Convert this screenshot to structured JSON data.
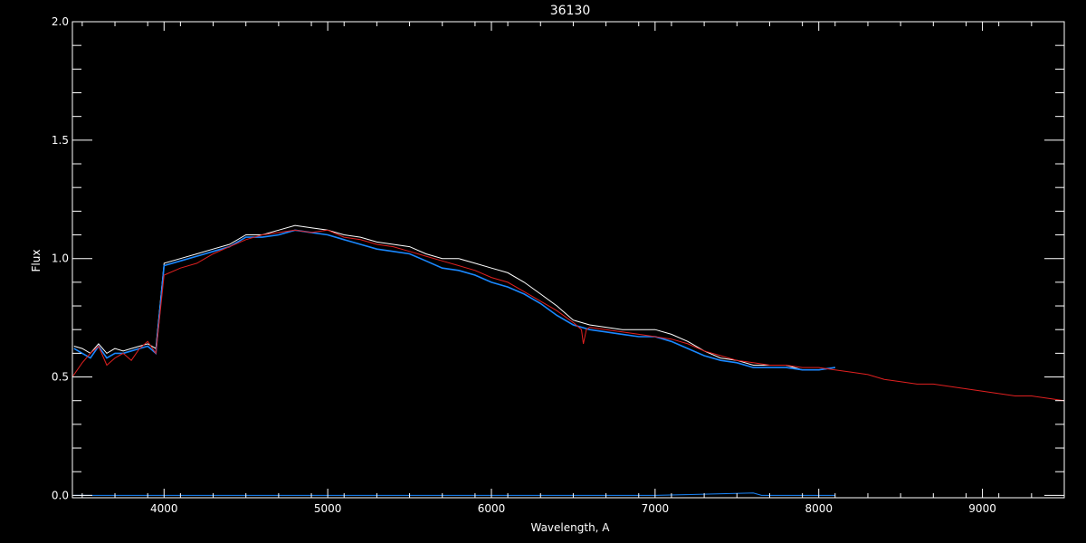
{
  "chart_data": {
    "type": "line",
    "title": "36130",
    "xlabel": "Wavelength, A",
    "ylabel": "Flux",
    "xlim": [
      3440,
      9500
    ],
    "ylim": [
      -0.01,
      2.0
    ],
    "x_ticks": [
      4000,
      5000,
      6000,
      7000,
      8000,
      9000
    ],
    "y_ticks": [
      0.0,
      0.5,
      1.0,
      1.5,
      2.0
    ],
    "x_tick_labels": [
      "4000",
      "5000",
      "6000",
      "7000",
      "8000",
      "9000"
    ],
    "y_tick_labels": [
      "0.0",
      "0.5",
      "1.0",
      "1.5",
      "2.0"
    ],
    "grid": false,
    "background": "#000000",
    "axis_color": "#ffffff",
    "series": [
      {
        "color": "#ffffff",
        "x": [
          3450,
          3500,
          3550,
          3600,
          3650,
          3700,
          3750,
          3800,
          3850,
          3900,
          3950,
          4000,
          4100,
          4200,
          4300,
          4400,
          4500,
          4600,
          4700,
          4800,
          4900,
          5000,
          5100,
          5200,
          5300,
          5400,
          5500,
          5600,
          5700,
          5800,
          5900,
          6000,
          6100,
          6200,
          6300,
          6400,
          6500,
          6600,
          6700,
          6800,
          6900,
          7000,
          7100,
          7200,
          7300,
          7400,
          7500,
          7600,
          7700,
          7800,
          7900,
          8000,
          8100
        ],
        "y": [
          0.63,
          0.62,
          0.6,
          0.64,
          0.6,
          0.62,
          0.61,
          0.62,
          0.63,
          0.64,
          0.62,
          0.98,
          1.0,
          1.02,
          1.04,
          1.06,
          1.1,
          1.1,
          1.12,
          1.14,
          1.13,
          1.12,
          1.1,
          1.09,
          1.07,
          1.06,
          1.05,
          1.02,
          1.0,
          1.0,
          0.98,
          0.96,
          0.94,
          0.9,
          0.85,
          0.8,
          0.74,
          0.72,
          0.71,
          0.7,
          0.7,
          0.7,
          0.68,
          0.65,
          0.61,
          0.58,
          0.57,
          0.55,
          0.55,
          0.55,
          0.53,
          0.53,
          0.54
        ]
      },
      {
        "color": "#1a88ff",
        "x": [
          3450,
          3500,
          3550,
          3600,
          3650,
          3700,
          3750,
          3800,
          3850,
          3900,
          3950,
          4000,
          4100,
          4200,
          4300,
          4400,
          4500,
          4600,
          4700,
          4800,
          4900,
          5000,
          5100,
          5200,
          5300,
          5400,
          5500,
          5600,
          5700,
          5800,
          5900,
          6000,
          6100,
          6200,
          6300,
          6400,
          6500,
          6600,
          6700,
          6800,
          6900,
          7000,
          7100,
          7200,
          7300,
          7400,
          7500,
          7600,
          7700,
          7800,
          7900,
          8000,
          8100
        ],
        "y": [
          0.62,
          0.6,
          0.58,
          0.63,
          0.58,
          0.6,
          0.6,
          0.61,
          0.62,
          0.63,
          0.6,
          0.97,
          0.99,
          1.01,
          1.03,
          1.05,
          1.09,
          1.09,
          1.1,
          1.12,
          1.11,
          1.1,
          1.08,
          1.06,
          1.04,
          1.03,
          1.02,
          0.99,
          0.96,
          0.95,
          0.93,
          0.9,
          0.88,
          0.85,
          0.81,
          0.76,
          0.72,
          0.7,
          0.69,
          0.68,
          0.67,
          0.67,
          0.65,
          0.62,
          0.59,
          0.57,
          0.56,
          0.54,
          0.54,
          0.54,
          0.53,
          0.53,
          0.54
        ]
      },
      {
        "color": "#e02020",
        "x": [
          3440,
          3500,
          3550,
          3600,
          3650,
          3700,
          3750,
          3800,
          3850,
          3900,
          3950,
          4000,
          4100,
          4200,
          4300,
          4400,
          4500,
          4600,
          4700,
          4800,
          4900,
          5000,
          5100,
          5200,
          5300,
          5400,
          5500,
          5600,
          5700,
          5800,
          5900,
          6000,
          6100,
          6200,
          6300,
          6400,
          6500,
          6550,
          6562,
          6580,
          6600,
          6700,
          6800,
          6900,
          7000,
          7100,
          7200,
          7300,
          7400,
          7500,
          7600,
          7700,
          7800,
          7900,
          8000,
          8100,
          8200,
          8300,
          8400,
          8500,
          8600,
          8700,
          8800,
          8900,
          9000,
          9100,
          9200,
          9300,
          9400,
          9500
        ],
        "y": [
          0.5,
          0.56,
          0.6,
          0.63,
          0.55,
          0.58,
          0.6,
          0.57,
          0.62,
          0.65,
          0.6,
          0.93,
          0.96,
          0.98,
          1.02,
          1.05,
          1.08,
          1.1,
          1.11,
          1.12,
          1.11,
          1.12,
          1.09,
          1.08,
          1.06,
          1.05,
          1.03,
          1.01,
          0.99,
          0.97,
          0.95,
          0.92,
          0.9,
          0.86,
          0.82,
          0.78,
          0.73,
          0.7,
          0.64,
          0.7,
          0.71,
          0.7,
          0.69,
          0.68,
          0.67,
          0.66,
          0.64,
          0.61,
          0.59,
          0.57,
          0.56,
          0.55,
          0.55,
          0.54,
          0.54,
          0.53,
          0.52,
          0.51,
          0.49,
          0.48,
          0.47,
          0.47,
          0.46,
          0.45,
          0.44,
          0.43,
          0.42,
          0.42,
          0.41,
          0.4
        ]
      },
      {
        "color": "#1a88ff",
        "x": [
          3450,
          4000,
          5000,
          6000,
          7000,
          7600,
          7650,
          8100
        ],
        "y": [
          0.0,
          0.0,
          0.0,
          0.0,
          0.0,
          0.01,
          0.0,
          0.0
        ]
      }
    ]
  }
}
